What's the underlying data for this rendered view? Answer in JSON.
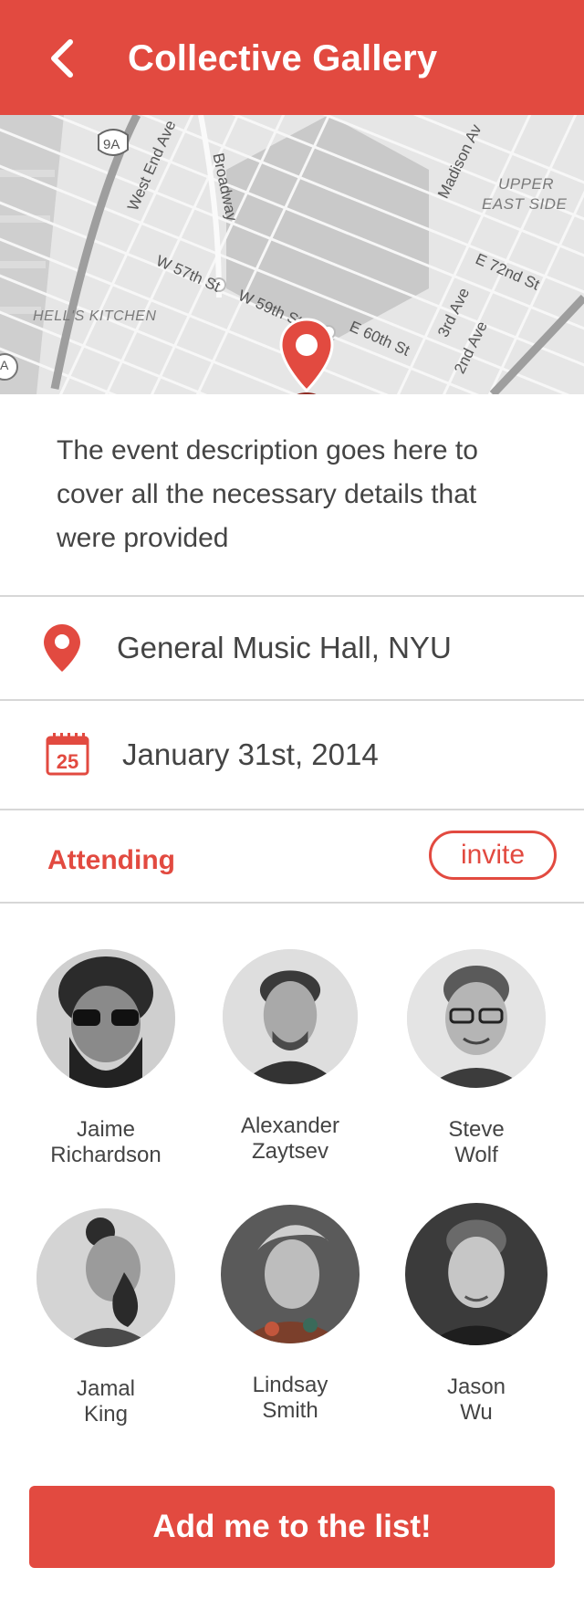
{
  "header": {
    "title": "Collective Gallery",
    "back_icon": "chevron-left-icon"
  },
  "map": {
    "labels": {
      "route_9a": "9A",
      "west_end": "West End Ave",
      "broadway": "Broadway",
      "madison": "Madison Av",
      "upper_east_1": "UPPER",
      "upper_east_2": "EAST SIDE",
      "e72": "E 72nd St",
      "w57": "W 57th St",
      "w59": "W 59th St",
      "third_ave": "3rd Ave",
      "second_ave": "2nd Ave",
      "e60": "E 60th St",
      "hells_kitchen": "HELL'S KITCHEN",
      "route_a": "A"
    },
    "pin_icon": "map-pin-icon"
  },
  "event": {
    "description": "The event description goes here to cover all the necessary details that were provided",
    "location": "General Music Hall, NYU",
    "location_icon": "location-pin-icon",
    "date": "January 31st, 2014",
    "calendar_icon": "calendar-icon",
    "calendar_day": "25"
  },
  "attending": {
    "label": "Attending",
    "invite_label": "invite",
    "people": [
      {
        "first": "Jaime",
        "last": "Richardson"
      },
      {
        "first": "Alexander",
        "last": "Zaytsev"
      },
      {
        "first": "Steve",
        "last": "Wolf"
      },
      {
        "first": "Jamal",
        "last": "King"
      },
      {
        "first": "Lindsay",
        "last": "Smith"
      },
      {
        "first": "Jason",
        "last": "Wu"
      }
    ]
  },
  "cta": {
    "label": "Add me to the list!"
  },
  "colors": {
    "accent": "#e24a40",
    "text": "#444444",
    "divider": "#d7d7d7"
  }
}
